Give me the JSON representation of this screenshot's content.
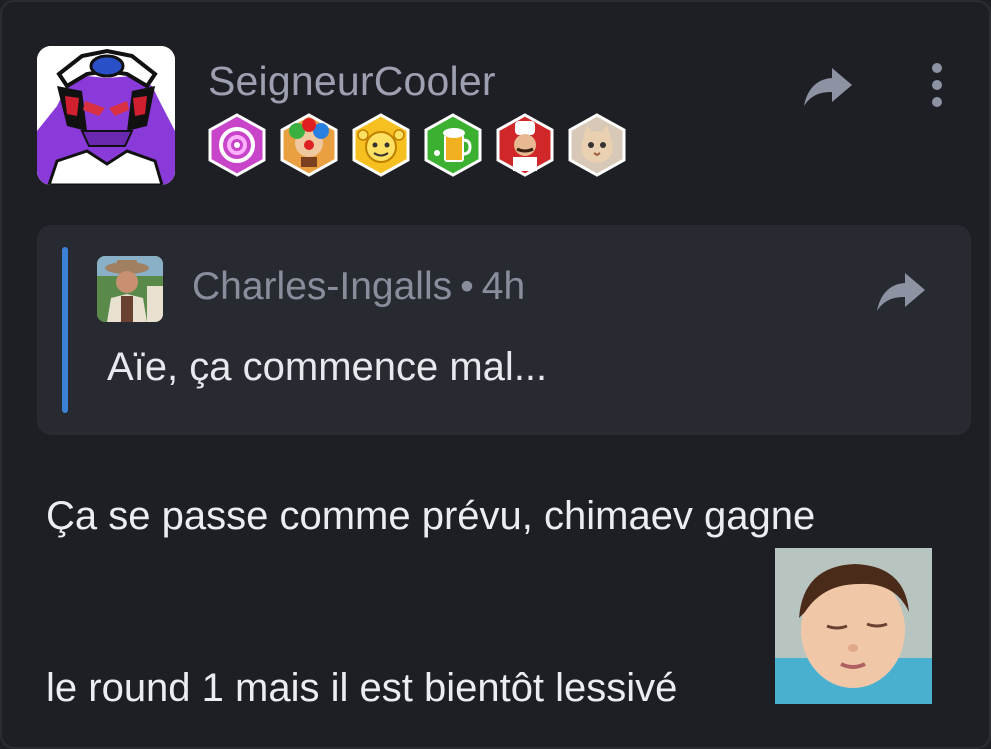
{
  "post": {
    "username": "SeigneurCooler",
    "avatar_icon": "cooler-avatar-icon",
    "badges": [
      {
        "icon": "purple-swirl-badge-icon",
        "color": "#c844c8"
      },
      {
        "icon": "clown-badge-icon",
        "color": "#e8a040"
      },
      {
        "icon": "smiley-hands-badge-icon",
        "color": "#f5c020"
      },
      {
        "icon": "beer-badge-icon",
        "color": "#3cb030"
      },
      {
        "icon": "chef-badge-icon",
        "color": "#d02828"
      },
      {
        "icon": "cat-badge-icon",
        "color": "#d8c8b8"
      }
    ],
    "actions": {
      "share_icon": "share-icon",
      "more_icon": "more-vertical-icon"
    }
  },
  "quote": {
    "author": "Charles-Ingalls",
    "separator": "•",
    "time": "4h",
    "text": "Aïe, ça commence mal...",
    "accent": "#3b82d6"
  },
  "body": {
    "line1": "Ça se passe comme prévu, chimaev gagne",
    "line2": "le round 1 mais il est bientôt lessivé",
    "sticker_icon": "sleepy-child-sticker-icon"
  }
}
